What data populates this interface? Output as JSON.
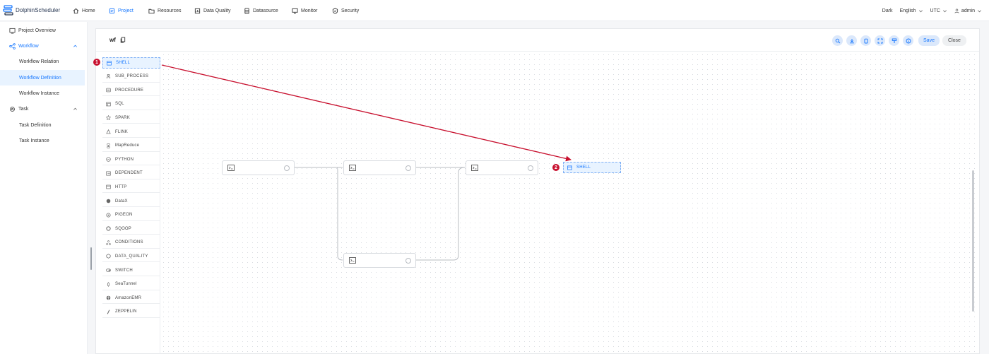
{
  "app": {
    "logo_text": "DolphinScheduler"
  },
  "nav": {
    "items": [
      {
        "label": "Home",
        "icon": "home-icon"
      },
      {
        "label": "Project",
        "icon": "project-icon",
        "active": true
      },
      {
        "label": "Resources",
        "icon": "folder-icon"
      },
      {
        "label": "Data Quality",
        "icon": "data-quality-icon"
      },
      {
        "label": "Datasource",
        "icon": "database-icon"
      },
      {
        "label": "Monitor",
        "icon": "monitor-icon"
      },
      {
        "label": "Security",
        "icon": "shield-icon"
      }
    ],
    "theme": "Dark",
    "language": "English",
    "timezone": "UTC",
    "user": "admin"
  },
  "sidebar": {
    "overview": "Project Overview",
    "workflow": "Workflow",
    "workflow_relation": "Workflow Relation",
    "workflow_definition": "Workflow Definition",
    "workflow_instance": "Workflow Instance",
    "task": "Task",
    "task_definition": "Task Definition",
    "task_instance": "Task Instance"
  },
  "editor": {
    "workflow_name": "wf",
    "save_label": "Save",
    "close_label": "Close"
  },
  "palette": [
    "SHELL",
    "SUB_PROCESS",
    "PROCEDURE",
    "SQL",
    "SPARK",
    "FLINK",
    "MapReduce",
    "PYTHON",
    "DEPENDENT",
    "HTTP",
    "DataX",
    "PIGEON",
    "SQOOP",
    "CONDITIONS",
    "DATA_QUALITY",
    "SWITCH",
    "SeaTunnel",
    "AmazonEMR",
    "ZEPPELIN"
  ],
  "drag": {
    "ghost_label": "SHELL",
    "step_1": "1",
    "step_2": "2",
    "arrow_color": "#c8102e"
  },
  "colors": {
    "accent": "#1677ff",
    "annotation": "#c8102e"
  }
}
